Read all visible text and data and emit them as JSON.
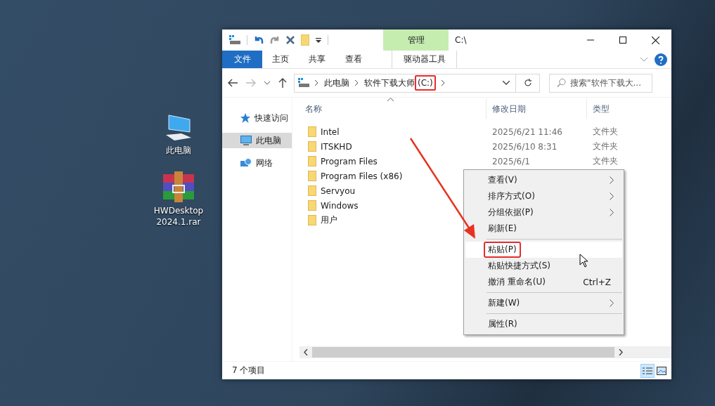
{
  "desktop_icons": [
    {
      "kind": "pc",
      "lines": [
        "此电脑"
      ]
    },
    {
      "kind": "archive",
      "lines": [
        "HWDesktop",
        "2024.1.rar"
      ]
    }
  ],
  "window": {
    "title": "C:\\",
    "context_group": "管理",
    "ribbon_tabs": [
      {
        "label": "文件",
        "kind": "file"
      },
      {
        "label": "主页",
        "kind": "tab"
      },
      {
        "label": "共享",
        "kind": "tab"
      },
      {
        "label": "查看",
        "kind": "tab"
      },
      {
        "label": "驱动器工具",
        "kind": "contextual"
      }
    ]
  },
  "address": {
    "crumbs": [
      {
        "name": "此电脑"
      },
      {
        "name": "软件下载大师",
        "drive": "(C:)",
        "highlighted": true
      }
    ],
    "search_placeholder": "搜索\"软件下载大..."
  },
  "sidebar": {
    "items": [
      {
        "label": "快速访问",
        "kind": "star",
        "selected": false
      },
      {
        "label": "此电脑",
        "kind": "pc",
        "selected": true
      },
      {
        "label": "网络",
        "kind": "network",
        "selected": false
      }
    ]
  },
  "table": {
    "columns": [
      "名称",
      "修改日期",
      "类型"
    ],
    "rows": [
      {
        "name": "Intel",
        "date": "2025/6/21 11:46",
        "type": "文件夹"
      },
      {
        "name": "ITSKHD",
        "date": "2025/6/10 8:31",
        "type": "文件夹"
      },
      {
        "name": "Program Files",
        "date": "2025/6/1",
        "type": "文件夹"
      },
      {
        "name": "Program Files (x86)"
      },
      {
        "name": "Servyou"
      },
      {
        "name": "Windows"
      },
      {
        "name": "用户"
      }
    ]
  },
  "context_menu": [
    {
      "kind": "item",
      "label": "查看(V)",
      "submenu": true,
      "selected": false,
      "highlighted": false
    },
    {
      "kind": "item",
      "label": "排序方式(O)",
      "submenu": true,
      "selected": false,
      "highlighted": false
    },
    {
      "kind": "item",
      "label": "分组依据(P)",
      "submenu": true,
      "selected": false,
      "highlighted": false
    },
    {
      "kind": "item",
      "label": "刷新(E)",
      "submenu": false,
      "selected": false,
      "highlighted": false
    },
    {
      "kind": "separator"
    },
    {
      "kind": "item",
      "label": "粘贴(P)",
      "submenu": false,
      "selected": true,
      "highlighted": true
    },
    {
      "kind": "item",
      "label": "粘贴快捷方式(S)",
      "submenu": false,
      "selected": false,
      "highlighted": false
    },
    {
      "kind": "item",
      "label": "撤消 重命名(U)",
      "shortcut": "Ctrl+Z",
      "submenu": false,
      "selected": false,
      "highlighted": false
    },
    {
      "kind": "separator"
    },
    {
      "kind": "item",
      "label": "新建(W)",
      "submenu": true,
      "selected": false,
      "highlighted": false
    },
    {
      "kind": "separator"
    },
    {
      "kind": "item",
      "label": "属性(R)",
      "submenu": false,
      "selected": false,
      "highlighted": false
    }
  ],
  "status_bar": {
    "count": "7 个项目",
    "views": [
      {
        "kind": "details",
        "selected": true
      },
      {
        "kind": "tiles",
        "selected": false
      }
    ]
  }
}
